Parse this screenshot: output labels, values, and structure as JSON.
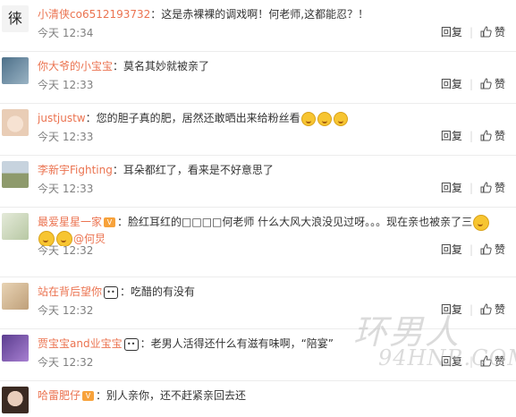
{
  "comments": [
    {
      "user": "小清侠co6512193732",
      "segments": [
        {
          "type": "text",
          "text": "：这是赤裸裸的调戏啊！何老师,这都能忍？！"
        }
      ],
      "time": "今天 12:34",
      "avatar_color": "#f3f3f3",
      "avatar_text": "徕"
    },
    {
      "user": "你大爷的小宝宝",
      "segments": [
        {
          "type": "text",
          "text": "：莫名其妙就被亲了"
        }
      ],
      "time": "今天 12:33",
      "avatar_color": "#6f8fa8"
    },
    {
      "user": "justjustw",
      "segments": [
        {
          "type": "text",
          "text": "：您的胆子真的肥，居然还敢晒出来给粉丝看"
        },
        {
          "type": "emoji"
        },
        {
          "type": "emoji"
        },
        {
          "type": "emoji"
        }
      ],
      "time": "今天 12:33",
      "avatar_color": "#f1d9c6"
    },
    {
      "user": "李新宇Fighting",
      "segments": [
        {
          "type": "text",
          "text": "：耳朵都红了，看来是不好意思了"
        }
      ],
      "time": "今天 12:33",
      "avatar_color": "#9aa77b"
    },
    {
      "user": "最爱星星一家",
      "vip": "V",
      "segments": [
        {
          "type": "text",
          "text": "：脸红耳红的□□□□何老师 什么大风大浪没见过呀。。。现在亲也被亲了三"
        },
        {
          "type": "emoji"
        },
        {
          "type": "emoji"
        },
        {
          "type": "emoji"
        },
        {
          "type": "at",
          "text": "@何炅"
        }
      ],
      "time": "今天 12:32",
      "avatar_color": "#c9d6b8"
    },
    {
      "user": "站在背后望你",
      "tag": "••",
      "segments": [
        {
          "type": "text",
          "text": "：吃醋的有没有"
        }
      ],
      "time": "今天 12:32",
      "avatar_color": "#d8c2a0"
    },
    {
      "user": "贾宝宝and业宝宝",
      "tag": "••",
      "segments": [
        {
          "type": "text",
          "text": "：老男人活得还什么有滋有味啊，“陪宴”"
        }
      ],
      "time": "今天 12:32",
      "avatar_color": "#7a5aa8"
    },
    {
      "user": "哈雷肥仔",
      "vip": "V",
      "segments": [
        {
          "type": "text",
          "text": "：别人亲你，还不赶紧亲回去还"
        }
      ],
      "time": "",
      "avatar_color": "#d4b7a4"
    }
  ],
  "actions": {
    "reply": "回复",
    "like": "赞"
  },
  "watermark": {
    "line1": "环男人",
    "line2": "94HNR.COM"
  }
}
